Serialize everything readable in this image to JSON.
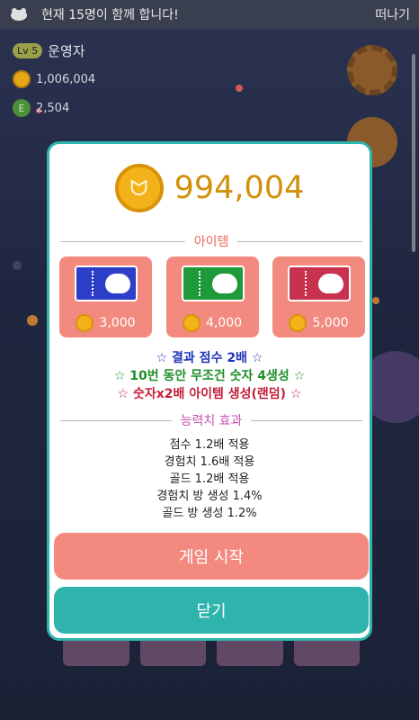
{
  "topbar": {
    "message": "현재 15명이 함께 합니다!",
    "leave_label": "떠나기"
  },
  "profile": {
    "level": "Lv 5",
    "name": "운영자",
    "coins": "1,006,004",
    "exp_icon": "E",
    "exp": "2,504"
  },
  "dialog": {
    "coin_amount": "994,004",
    "items_title": "아이템",
    "items": [
      {
        "color": "#2d3fc9",
        "icon": "ticket-cloud-icon",
        "price": "3,000"
      },
      {
        "color": "#1f9a3a",
        "icon": "ticket-bear-icon",
        "price": "4,000"
      },
      {
        "color": "#c8324f",
        "icon": "ticket-cloud-icon",
        "price": "5,000"
      }
    ],
    "effects": [
      {
        "text": "☆ 결과 점수 2배 ☆",
        "color": "#1f34b8"
      },
      {
        "text": "☆ 10번 동안 무조건 숫자 4생성 ☆",
        "color": "#1f8f2a"
      },
      {
        "text": "☆ 숫자x2배 아이템 생성(랜덤) ☆",
        "color": "#c4203a"
      }
    ],
    "stats_title": "능력치 효과",
    "stats": [
      "점수 1.2배 적용",
      "경험치 1.6배 적용",
      "골드 1.2배 적용",
      "경험치 방 생성 1.4%",
      "골드 방 생성 1.2%"
    ],
    "start_label": "게임 시작",
    "close_label": "닫기"
  },
  "colors": {
    "accent_teal": "#2fb3ad",
    "salmon": "#f28a80",
    "gold": "#d1900a"
  }
}
